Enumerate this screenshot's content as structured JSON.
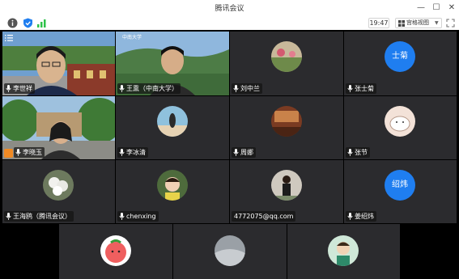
{
  "window": {
    "title": "腾讯会议",
    "minimize_glyph": "—",
    "maximize_glyph": "☐",
    "close_glyph": "✕"
  },
  "toolbar": {
    "timer": "19:47",
    "view_label": "宫格视图",
    "icons": [
      "info-icon",
      "shield-icon",
      "signal-icon",
      "grid-view-icon",
      "fullscreen-icon"
    ]
  },
  "participants": [
    {
      "name": "李世祥",
      "type": "video"
    },
    {
      "name": "王熏（中南大学）",
      "type": "video",
      "active_speaker": true
    },
    {
      "name": "刘中兰",
      "type": "avatar",
      "avatar": "photo"
    },
    {
      "name": "张士菊",
      "type": "avatar",
      "avatar_text": "士菊"
    },
    {
      "name": "李晓玉",
      "type": "video",
      "hand_raised": true
    },
    {
      "name": "李冰清",
      "type": "avatar",
      "avatar": "photo"
    },
    {
      "name": "周娜",
      "type": "avatar",
      "avatar": "photo"
    },
    {
      "name": "张节",
      "type": "avatar",
      "avatar": "photo"
    },
    {
      "name": "王海鸥（腾讯会议）",
      "type": "avatar",
      "avatar": "photo"
    },
    {
      "name": "chenxing",
      "type": "avatar",
      "avatar": "photo"
    },
    {
      "name": "4772075@qq.com",
      "type": "avatar",
      "avatar": "photo"
    },
    {
      "name": "姜绍炜",
      "type": "avatar",
      "avatar_text": "绍炜"
    },
    {
      "name": "",
      "type": "avatar",
      "avatar": "photo"
    },
    {
      "name": "",
      "type": "avatar",
      "avatar": "photo"
    },
    {
      "name": "",
      "type": "avatar",
      "avatar": "photo"
    }
  ],
  "colors": {
    "tile_bg": "#2b2b2e",
    "grid_bg": "#000000",
    "avatar_blue": "#1f7ef0",
    "active_border": "#2ec24a",
    "hand_orange": "#f08a24"
  }
}
